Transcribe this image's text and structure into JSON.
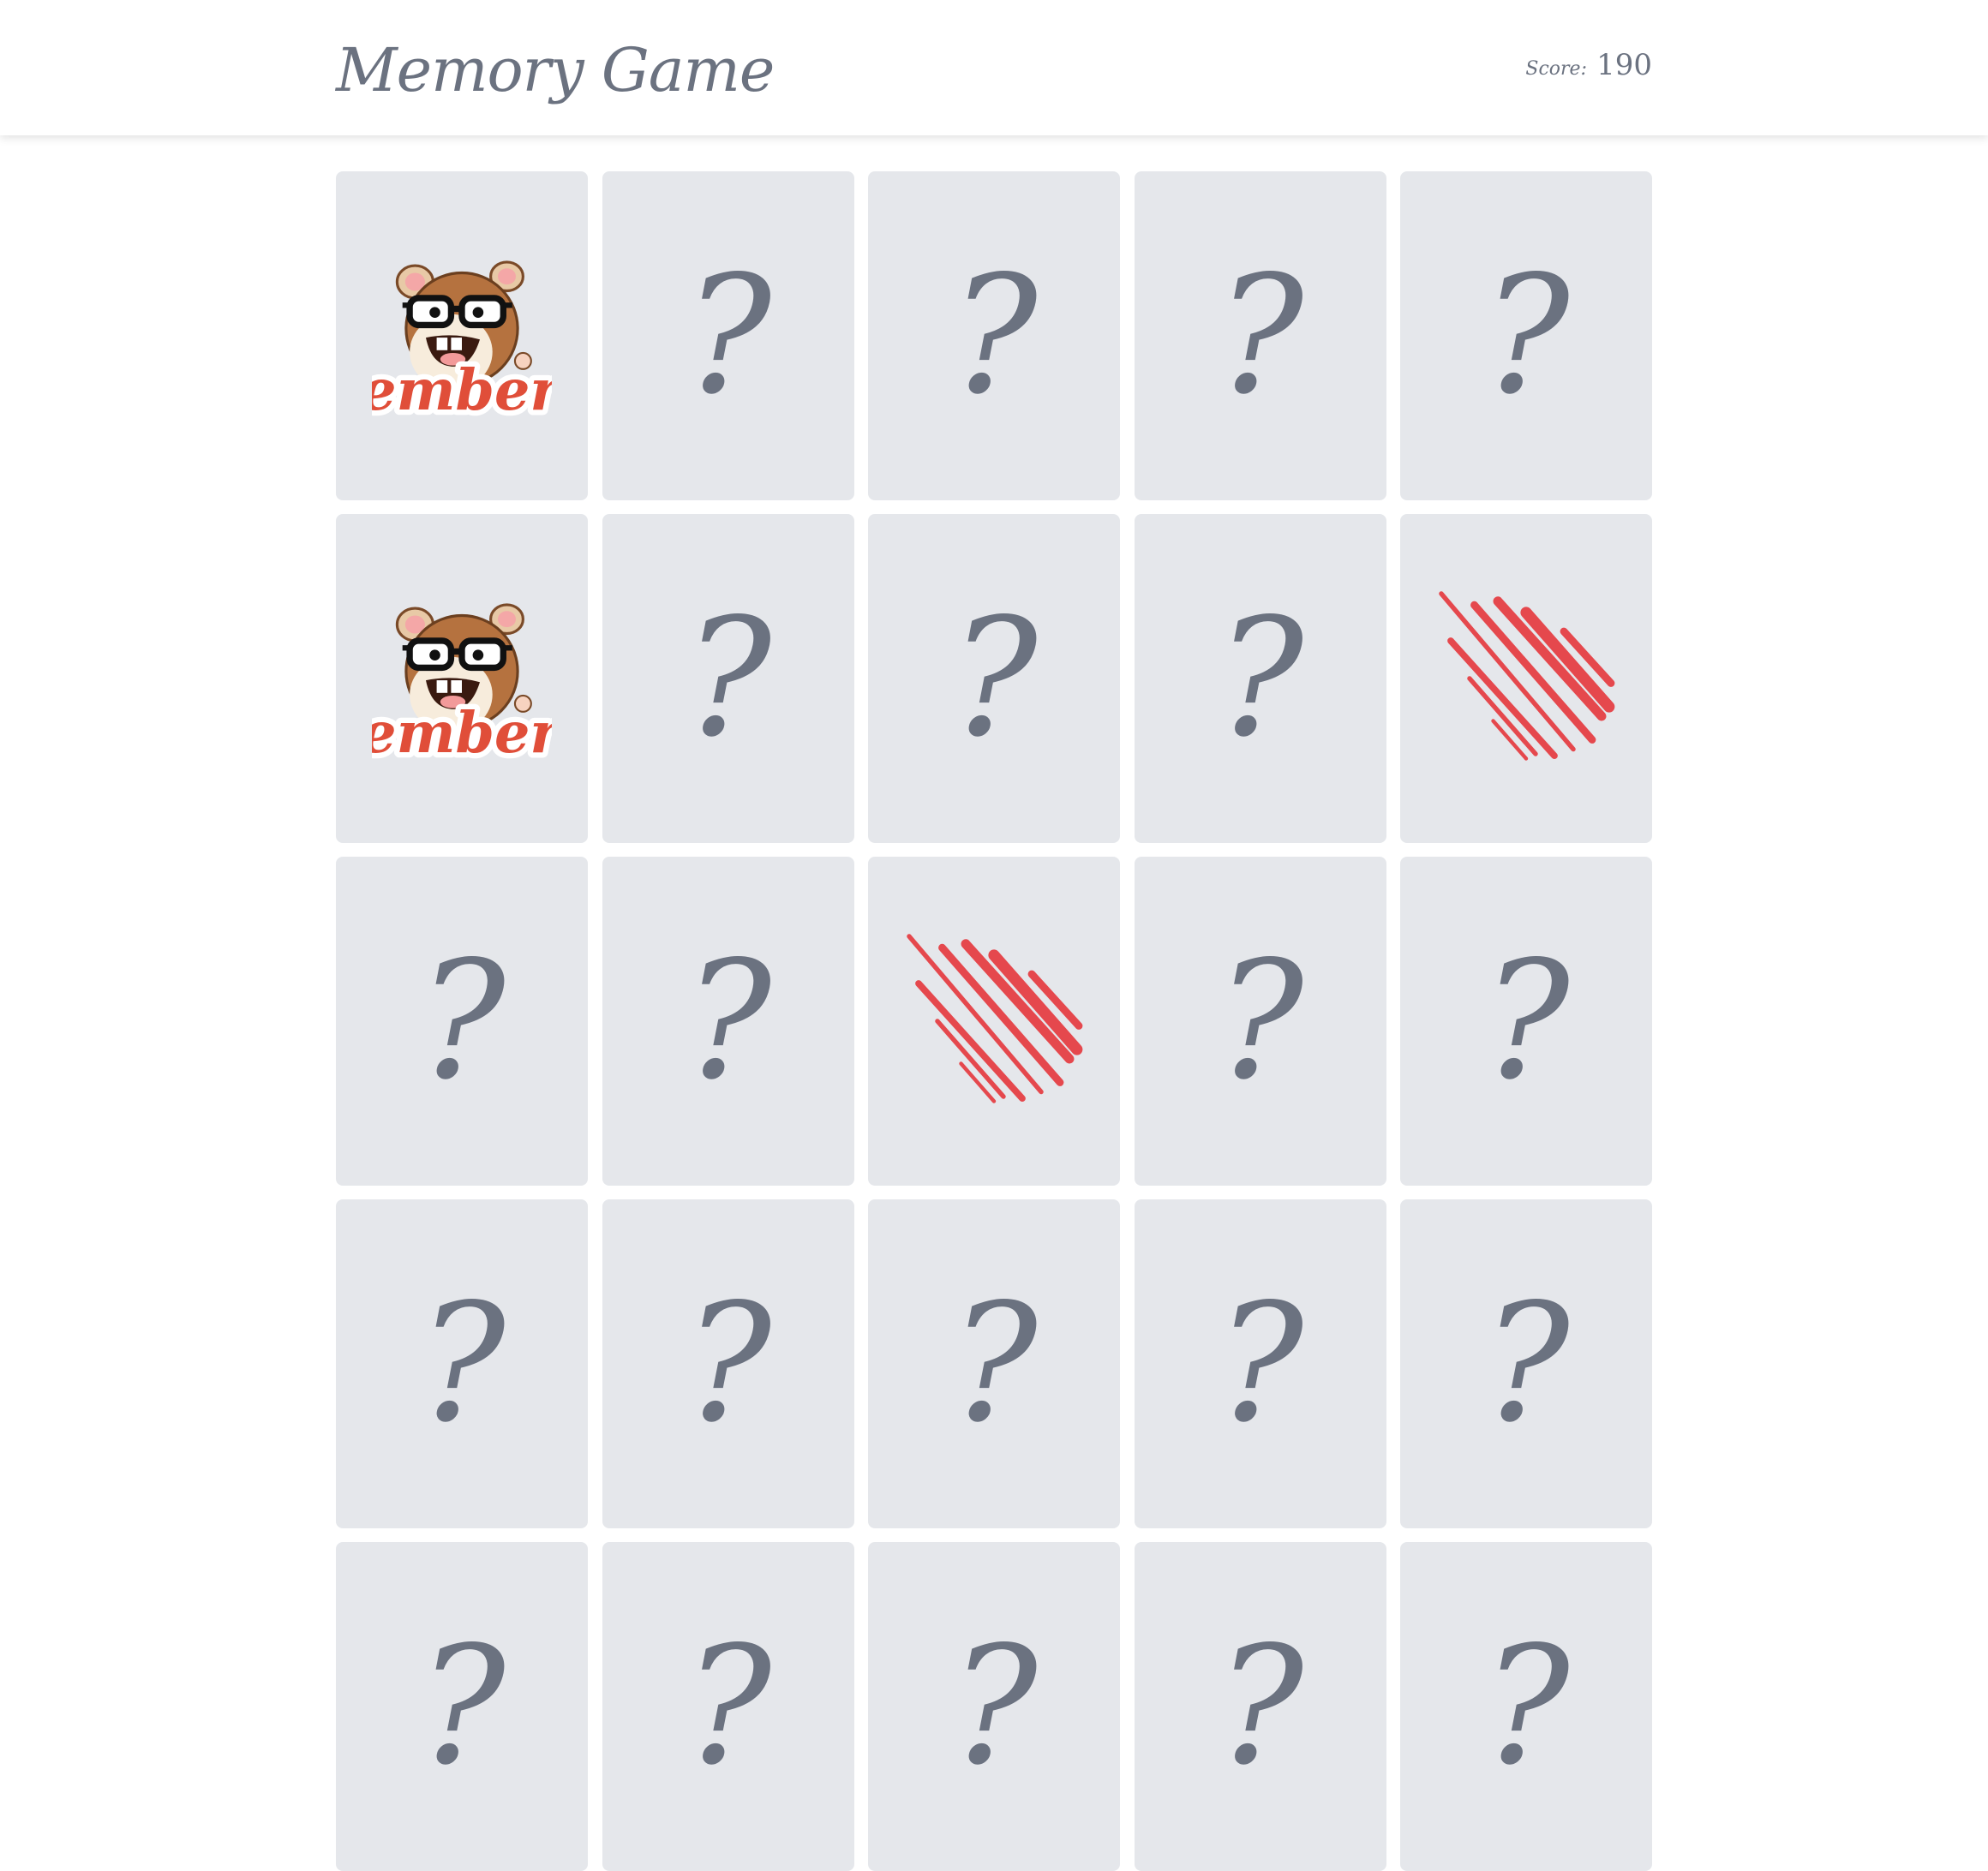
{
  "header": {
    "title": "Memory Game",
    "score_label": "Score:",
    "score_value": "190"
  },
  "cards": [
    {
      "state": "revealed",
      "face": "ember",
      "text": "ember"
    },
    {
      "state": "hidden",
      "face": "question",
      "text": "?"
    },
    {
      "state": "hidden",
      "face": "question",
      "text": "?"
    },
    {
      "state": "hidden",
      "face": "question",
      "text": "?"
    },
    {
      "state": "hidden",
      "face": "question",
      "text": "?"
    },
    {
      "state": "revealed",
      "face": "ember",
      "text": "ember"
    },
    {
      "state": "hidden",
      "face": "question",
      "text": "?"
    },
    {
      "state": "hidden",
      "face": "question",
      "text": "?"
    },
    {
      "state": "hidden",
      "face": "question",
      "text": "?"
    },
    {
      "state": "revealed",
      "face": "meteor",
      "text": ""
    },
    {
      "state": "hidden",
      "face": "question",
      "text": "?"
    },
    {
      "state": "hidden",
      "face": "question",
      "text": "?"
    },
    {
      "state": "revealed",
      "face": "meteor",
      "text": ""
    },
    {
      "state": "hidden",
      "face": "question",
      "text": "?"
    },
    {
      "state": "hidden",
      "face": "question",
      "text": "?"
    },
    {
      "state": "hidden",
      "face": "question",
      "text": "?"
    },
    {
      "state": "hidden",
      "face": "question",
      "text": "?"
    },
    {
      "state": "hidden",
      "face": "question",
      "text": "?"
    },
    {
      "state": "hidden",
      "face": "question",
      "text": "?"
    },
    {
      "state": "hidden",
      "face": "question",
      "text": "?"
    },
    {
      "state": "hidden",
      "face": "question",
      "text": "?"
    },
    {
      "state": "hidden",
      "face": "question",
      "text": "?"
    },
    {
      "state": "hidden",
      "face": "question",
      "text": "?"
    },
    {
      "state": "hidden",
      "face": "question",
      "text": "?"
    },
    {
      "state": "hidden",
      "face": "question",
      "text": "?"
    }
  ],
  "colors": {
    "card_bg": "#e5e7eb",
    "text": "#6b7280",
    "ember_red": "#e04e39",
    "meteor_red": "#e5484d"
  }
}
